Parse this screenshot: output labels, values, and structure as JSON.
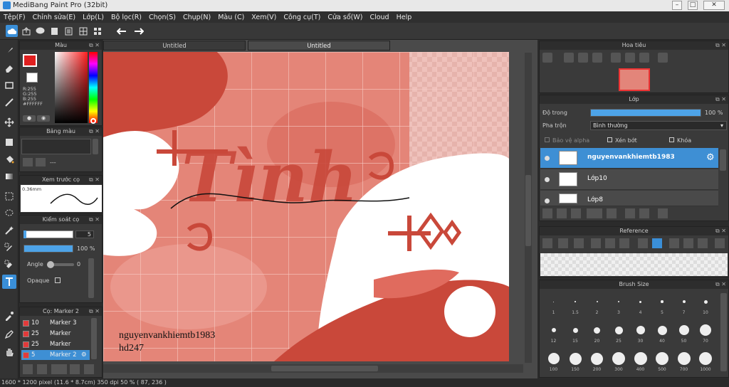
{
  "window": {
    "title": "MediBang Paint Pro (32bit)"
  },
  "menu": [
    "Tệp(F)",
    "Chỉnh sửa(E)",
    "Lớp(L)",
    "Bộ lọc(R)",
    "Chọn(S)",
    "Chụp(N)",
    "Màu (C)",
    "Xem(V)",
    "Công cụ(T)",
    "Cửa sổ(W)",
    "Cloud",
    "Help"
  ],
  "toolbar": {
    "icons": [
      "cloud-icon",
      "export-icon",
      "chat-icon",
      "document-icon",
      "page-icon",
      "grid-icon",
      "undo-icon",
      "redo-icon"
    ]
  },
  "tools": [
    "brush-icon",
    "eraser-icon",
    "rectangle-icon",
    "line-icon",
    "move-icon",
    "fill-rect-icon",
    "bucket-icon",
    "gradient-icon",
    "select-rect-icon",
    "lasso-icon",
    "magic-wand-icon",
    "select-pen-icon",
    "select-eraser-icon",
    "text-icon",
    "eyedropper-icon",
    "pen-icon",
    "hand-icon"
  ],
  "color_panel": {
    "title": "Màu",
    "r": "R:255",
    "g": "G:255",
    "b": "B:255",
    "hex": "#FFFFFF",
    "fg": "#e02020",
    "bg": "#ffffff"
  },
  "palette_panel": {
    "title": "Bảng màu",
    "dash": "---"
  },
  "preview_panel": {
    "title": "Xem trước cọ",
    "size": "0.36mm"
  },
  "brush_control": {
    "title": "Kiểm soát cọ",
    "size": "5",
    "opacity": "100 %",
    "opacity_value": 1.0,
    "angle_label": "Angle",
    "angle_value": "0",
    "opaque_label": "Opaque"
  },
  "brush_list": {
    "title": "Cọ: Marker 2",
    "items": [
      {
        "size": "10",
        "name": "Marker 3"
      },
      {
        "size": "25",
        "name": "Marker"
      },
      {
        "size": "25",
        "name": "Marker"
      },
      {
        "size": "5",
        "name": "Marker 2"
      }
    ]
  },
  "tabs": [
    "Untitled",
    "Untitled"
  ],
  "canvas": {
    "watermark1": "nguyenvankhiemtb1983",
    "watermark2": "hd247",
    "script_title": "Tình"
  },
  "navigator": {
    "title": "Hoa tiêu"
  },
  "layer_panel": {
    "title": "Lớp",
    "opacity_label": "Độ trong",
    "opacity_value": "100 %",
    "opacity_fraction": 1.0,
    "blend_label": "Pha trộn",
    "blend_value": "Bình thường",
    "protect_alpha": "Bảo vệ alpha",
    "clipping": "Xén bớt",
    "lock": "Khóa",
    "layers": [
      "nguyenvankhiemtb1983",
      "Lớp10",
      "Lớp8"
    ]
  },
  "reference": {
    "title": "Reference"
  },
  "brush_size": {
    "title": "Brush Size",
    "sizes": [
      "1",
      "1.5",
      "2",
      "3",
      "4",
      "5",
      "7",
      "10",
      "12",
      "15",
      "20",
      "25",
      "30",
      "40",
      "50",
      "70",
      "100",
      "150",
      "200",
      "300",
      "400",
      "500",
      "700",
      "1000"
    ]
  },
  "status": {
    "text": "1600 * 1200 pixel   (11.6 * 8.7cm)  350 dpi  50 %   ( 87, 236 )"
  },
  "colors": {
    "accent": "#3a8fd8",
    "coral": "#e06b5e",
    "coral_dark": "#c8483b"
  }
}
